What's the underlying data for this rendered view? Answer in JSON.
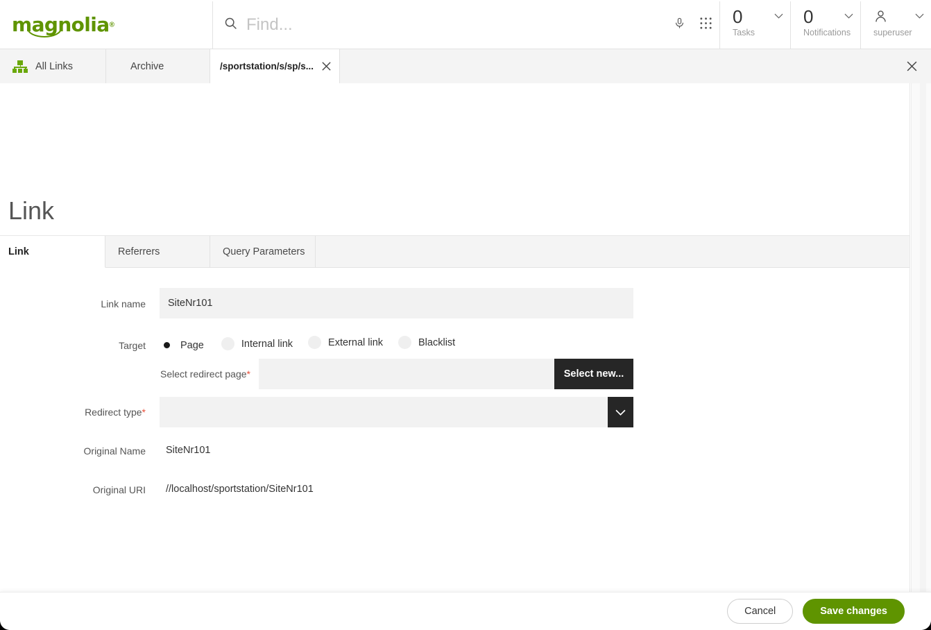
{
  "brand": {
    "logo_text": "magnolia",
    "logo_reg": "®",
    "green": "#5f9400",
    "dark": "#262626"
  },
  "header": {
    "search_placeholder": "Find...",
    "search_value": "",
    "mic_icon": "microphone-icon",
    "apps_icon": "apps-grid-icon",
    "tasks": {
      "count": "0",
      "label": "Tasks"
    },
    "notifications": {
      "count": "0",
      "label": "Notifications"
    },
    "user": {
      "label": "superuser",
      "icon": "user-icon"
    }
  },
  "app_tabs": {
    "items": [
      {
        "label": "All Links",
        "icon": "hierarchy-icon",
        "active": false
      },
      {
        "label": "Archive",
        "icon": "",
        "active": false
      },
      {
        "label": "/sportstation/s/sp/s...",
        "icon": "",
        "active": true,
        "closable": true
      }
    ],
    "close_all_icon": "close-icon"
  },
  "page": {
    "title": "Link"
  },
  "form_tabs": {
    "items": [
      {
        "label": "Link",
        "active": true
      },
      {
        "label": "Referrers",
        "active": false
      },
      {
        "label": "Query Parameters",
        "active": false
      }
    ]
  },
  "form": {
    "link_name": {
      "label": "Link name",
      "value": "SiteNr101",
      "placeholder": ""
    },
    "target": {
      "label": "Target",
      "options": [
        {
          "label": "Page",
          "selected": true
        },
        {
          "label": "Internal link",
          "selected": false
        },
        {
          "label": "External link",
          "selected": false
        },
        {
          "label": "Blacklist",
          "selected": false
        }
      ]
    },
    "select_redirect_page": {
      "label": "Select redirect page",
      "required": "*",
      "value": "",
      "placeholder": "",
      "button_label": "Select new..."
    },
    "redirect_type": {
      "label": "Redirect type",
      "required": "*",
      "value": "",
      "placeholder": "",
      "chevron_icon": "chevron-down-icon"
    },
    "original_name": {
      "label": "Original Name",
      "value": "SiteNr101"
    },
    "original_uri": {
      "label": "Original URI",
      "value": "//localhost/sportstation/SiteNr101"
    }
  },
  "footer": {
    "cancel_label": "Cancel",
    "save_label": "Save changes"
  }
}
